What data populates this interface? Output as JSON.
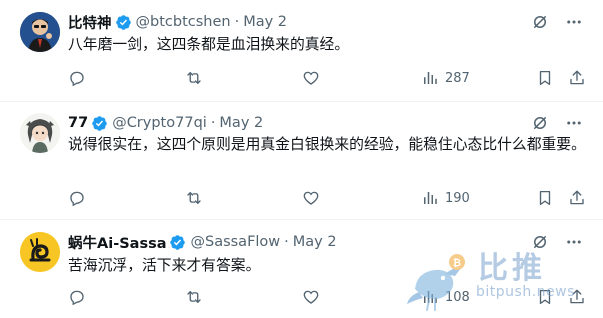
{
  "tweets": [
    {
      "name": "比特神",
      "handle": "@btcbtcshen",
      "dot": "·",
      "date": "May 2",
      "text": "八年磨一剑，这四条都是血泪换来的真经。",
      "views": "287",
      "avatar": "avatar-man-suit"
    },
    {
      "name": "77",
      "handle": "@Crypto77qi",
      "dot": "·",
      "date": "May 2",
      "text": "说得很实在，这四个原则是用真金白银换来的经验，能稳住心态比什么都重要。",
      "views": "190",
      "avatar": "avatar-anime-girl"
    },
    {
      "name": "蜗牛Ai-Sassa",
      "handle": "@SassaFlow",
      "dot": "·",
      "date": "May 2",
      "text": "苦海沉浮，活下来才有答案。",
      "views": "108",
      "avatar": "avatar-snail-logo"
    }
  ],
  "watermark": {
    "cn": "比推",
    "en": "bitpush.news"
  },
  "colors": {
    "verified": "#1d9bf0",
    "muted": "#536471",
    "text": "#0f1419",
    "watermark": "#7aa2cd"
  }
}
